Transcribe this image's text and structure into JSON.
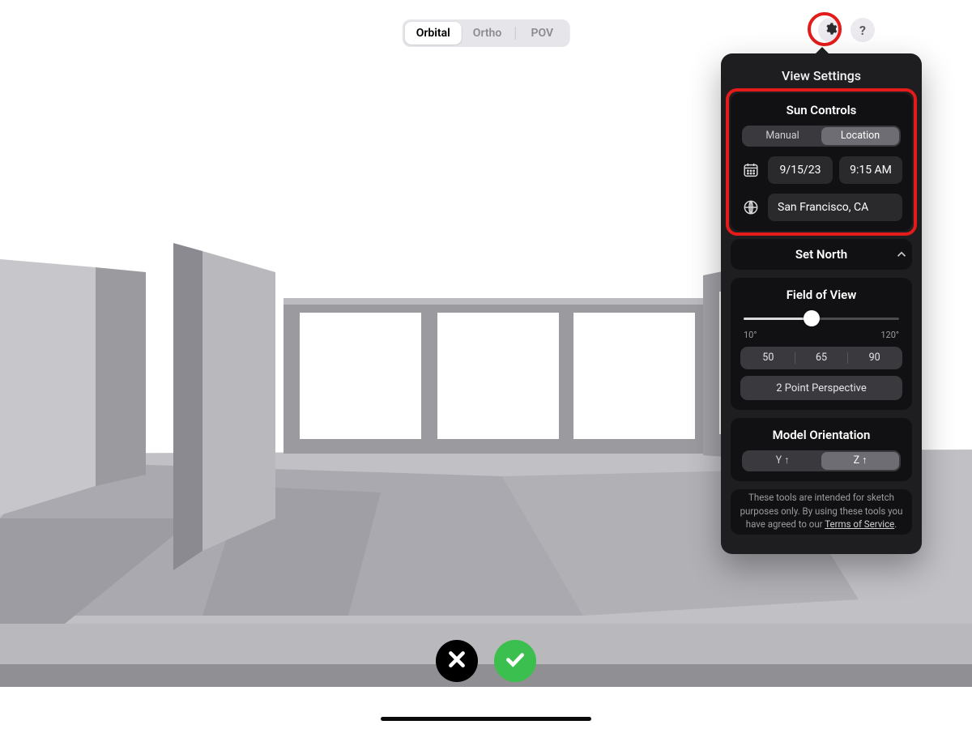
{
  "camera_modes": {
    "orbital": "Orbital",
    "ortho": "Ortho",
    "pov": "POV",
    "active": "orbital"
  },
  "top_right": {
    "help_label": "?"
  },
  "popover": {
    "title": "View Settings",
    "sun": {
      "heading": "Sun Controls",
      "manual_label": "Manual",
      "location_label": "Location",
      "active_mode": "location",
      "date": "9/15/23",
      "time": "9:15 AM",
      "location": "San Francisco, CA"
    },
    "set_north": {
      "label": "Set North"
    },
    "fov": {
      "heading": "Field of View",
      "min_label": "10°",
      "max_label": "120°",
      "preset_a": "50",
      "preset_b": "65",
      "preset_c": "90",
      "two_point_label": "2 Point Perspective"
    },
    "orientation": {
      "heading": "Model Orientation",
      "y_label": "Y ↑",
      "z_label": "Z ↑",
      "active": "z"
    },
    "disclaimer": {
      "prefix": "These tools are intended for sketch purposes only. By using these tools you have agreed to our ",
      "link": "Terms of Service",
      "suffix": "."
    }
  }
}
